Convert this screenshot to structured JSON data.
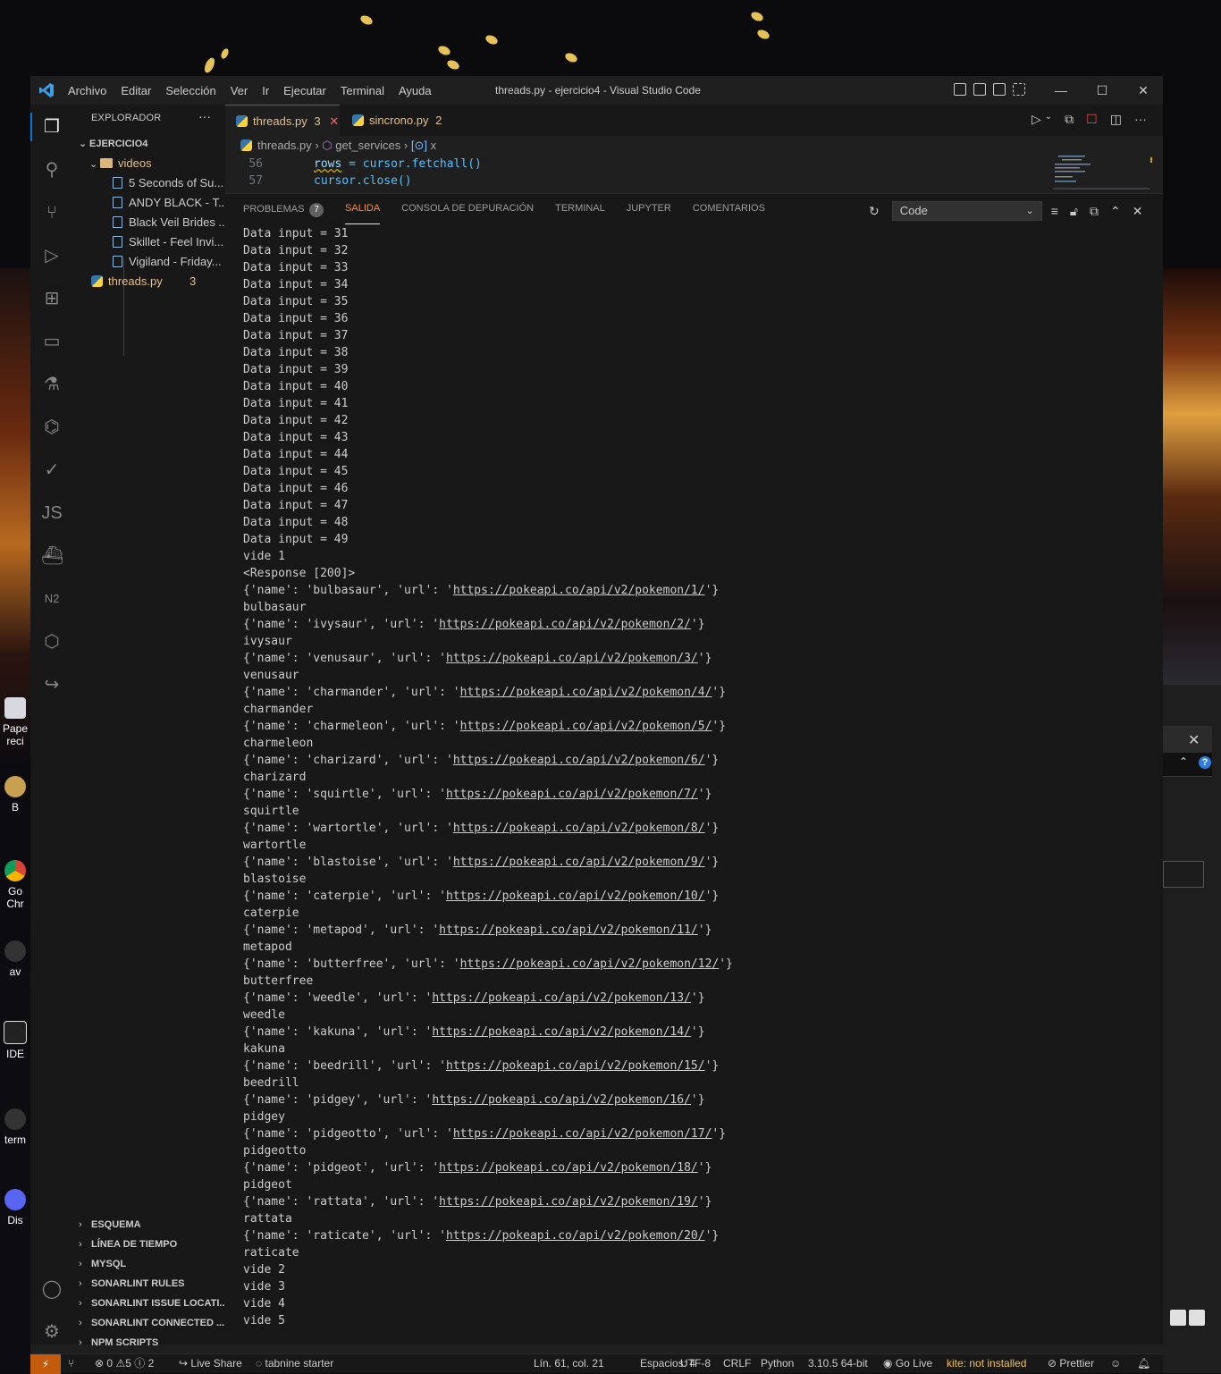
{
  "desktop": {
    "icons": [
      {
        "label": "Pape\nreci",
        "name": "recycle-bin"
      },
      {
        "label": "B",
        "name": "bitcoin-app"
      },
      {
        "label": "Go\nChr",
        "name": "google-chrome"
      },
      {
        "label": "av",
        "name": "app-av"
      },
      {
        "label": "IDE",
        "name": "ide-app"
      },
      {
        "label": "term",
        "name": "terminal-app"
      },
      {
        "label": "Dis",
        "name": "discord-app"
      }
    ]
  },
  "window": {
    "title": "threads.py - ejercicio4 - Visual Studio Code",
    "menu": [
      "Archivo",
      "Editar",
      "Selección",
      "Ver",
      "Ir",
      "Ejecutar",
      "Terminal",
      "Ayuda"
    ]
  },
  "sidebar": {
    "header": "EXPLORADOR",
    "root": "EJERCICIO4",
    "folder": "videos",
    "files": [
      "5 Seconds of Su...",
      "ANDY BLACK - T...",
      "Black Veil Brides ...",
      "Skillet - Feel Invi...",
      "Vigiland - Friday..."
    ],
    "threads_file": {
      "name": "threads.py",
      "problems": "3"
    },
    "sections": [
      "ESQUEMA",
      "LÍNEA DE TIEMPO",
      "MYSQL",
      "SONARLINT RULES",
      "SONARLINT ISSUE LOCATI...",
      "SONARLINT CONNECTED ...",
      "NPM SCRIPTS"
    ]
  },
  "tabs": [
    {
      "label": "threads.py",
      "count": "3",
      "close": "✕"
    },
    {
      "label": "sincrono.py",
      "count": "2"
    }
  ],
  "breadcrumb": {
    "file": "threads.py",
    "symbol": "get_services",
    "variable": "x"
  },
  "code": {
    "lines": [
      {
        "num": "56",
        "var": "rows",
        "rest": " = cursor.fetchall()"
      },
      {
        "num": "57",
        "var": "",
        "rest": "cursor.close()"
      }
    ]
  },
  "panel": {
    "tabs": [
      "PROBLEMAS",
      "SALIDA",
      "CONSOLA DE DEPURACIÓN",
      "TERMINAL",
      "JUPYTER",
      "COMENTARIOS"
    ],
    "problems_count": "7",
    "active_tab": "SALIDA",
    "channel": "Code",
    "output": [
      {
        "t": "Data input = 31"
      },
      {
        "t": "Data input = 32"
      },
      {
        "t": "Data input = 33"
      },
      {
        "t": "Data input = 34"
      },
      {
        "t": "Data input = 35"
      },
      {
        "t": "Data input = 36"
      },
      {
        "t": "Data input = 37"
      },
      {
        "t": "Data input = 38"
      },
      {
        "t": "Data input = 39"
      },
      {
        "t": "Data input = 40"
      },
      {
        "t": "Data input = 41"
      },
      {
        "t": "Data input = 42"
      },
      {
        "t": "Data input = 43"
      },
      {
        "t": "Data input = 44"
      },
      {
        "t": "Data input = 45"
      },
      {
        "t": "Data input = 46"
      },
      {
        "t": "Data input = 47"
      },
      {
        "t": "Data input = 48"
      },
      {
        "t": "Data input = 49"
      },
      {
        "t": "vide 1"
      },
      {
        "t": "<Response [200]>"
      },
      {
        "pre": "{'name': 'bulbasaur', 'url': '",
        "link": "https://pokeapi.co/api/v2/pokemon/1/",
        "post": "'}"
      },
      {
        "t": "bulbasaur"
      },
      {
        "pre": "{'name': 'ivysaur', 'url': '",
        "link": "https://pokeapi.co/api/v2/pokemon/2/",
        "post": "'}"
      },
      {
        "t": "ivysaur"
      },
      {
        "pre": "{'name': 'venusaur', 'url': '",
        "link": "https://pokeapi.co/api/v2/pokemon/3/",
        "post": "'}"
      },
      {
        "t": "venusaur"
      },
      {
        "pre": "{'name': 'charmander', 'url': '",
        "link": "https://pokeapi.co/api/v2/pokemon/4/",
        "post": "'}"
      },
      {
        "t": "charmander"
      },
      {
        "pre": "{'name': 'charmeleon', 'url': '",
        "link": "https://pokeapi.co/api/v2/pokemon/5/",
        "post": "'}"
      },
      {
        "t": "charmeleon"
      },
      {
        "pre": "{'name': 'charizard', 'url': '",
        "link": "https://pokeapi.co/api/v2/pokemon/6/",
        "post": "'}"
      },
      {
        "t": "charizard"
      },
      {
        "pre": "{'name': 'squirtle', 'url': '",
        "link": "https://pokeapi.co/api/v2/pokemon/7/",
        "post": "'}"
      },
      {
        "t": "squirtle"
      },
      {
        "pre": "{'name': 'wartortle', 'url': '",
        "link": "https://pokeapi.co/api/v2/pokemon/8/",
        "post": "'}"
      },
      {
        "t": "wartortle"
      },
      {
        "pre": "{'name': 'blastoise', 'url': '",
        "link": "https://pokeapi.co/api/v2/pokemon/9/",
        "post": "'}"
      },
      {
        "t": "blastoise"
      },
      {
        "pre": "{'name': 'caterpie', 'url': '",
        "link": "https://pokeapi.co/api/v2/pokemon/10/",
        "post": "'}"
      },
      {
        "t": "caterpie"
      },
      {
        "pre": "{'name': 'metapod', 'url': '",
        "link": "https://pokeapi.co/api/v2/pokemon/11/",
        "post": "'}"
      },
      {
        "t": "metapod"
      },
      {
        "pre": "{'name': 'butterfree', 'url': '",
        "link": "https://pokeapi.co/api/v2/pokemon/12/",
        "post": "'}"
      },
      {
        "t": "butterfree"
      },
      {
        "pre": "{'name': 'weedle', 'url': '",
        "link": "https://pokeapi.co/api/v2/pokemon/13/",
        "post": "'}"
      },
      {
        "t": "weedle"
      },
      {
        "pre": "{'name': 'kakuna', 'url': '",
        "link": "https://pokeapi.co/api/v2/pokemon/14/",
        "post": "'}"
      },
      {
        "t": "kakuna"
      },
      {
        "pre": "{'name': 'beedrill', 'url': '",
        "link": "https://pokeapi.co/api/v2/pokemon/15/",
        "post": "'}"
      },
      {
        "t": "beedrill"
      },
      {
        "pre": "{'name': 'pidgey', 'url': '",
        "link": "https://pokeapi.co/api/v2/pokemon/16/",
        "post": "'}"
      },
      {
        "t": "pidgey"
      },
      {
        "pre": "{'name': 'pidgeotto', 'url': '",
        "link": "https://pokeapi.co/api/v2/pokemon/17/",
        "post": "'}"
      },
      {
        "t": "pidgeotto"
      },
      {
        "pre": "{'name': 'pidgeot', 'url': '",
        "link": "https://pokeapi.co/api/v2/pokemon/18/",
        "post": "'}"
      },
      {
        "t": "pidgeot"
      },
      {
        "pre": "{'name': 'rattata', 'url': '",
        "link": "https://pokeapi.co/api/v2/pokemon/19/",
        "post": "'}"
      },
      {
        "t": "rattata"
      },
      {
        "pre": "{'name': 'raticate', 'url': '",
        "link": "https://pokeapi.co/api/v2/pokemon/20/",
        "post": "'}"
      },
      {
        "t": "raticate"
      },
      {
        "t": "vide 2"
      },
      {
        "t": "vide 3"
      },
      {
        "t": "vide 4"
      },
      {
        "t": "vide 5"
      }
    ]
  },
  "statusbar": {
    "errors": "0",
    "warnings": "5",
    "infos": "2",
    "live_share": "Live Share",
    "tabnine": "tabnine starter",
    "position": "Lín. 61, col. 21",
    "spaces": "Espacios: 4",
    "encoding": "UTF-8",
    "eol": "CRLF",
    "language": "Python",
    "interpreter": "3.10.5 64-bit",
    "go_live": "Go Live",
    "kite": "kite: not installed",
    "prettier": "Prettier"
  },
  "colors": {
    "accent": "#0078d4",
    "active_tab_label": "#e2c08d",
    "remote_indicator": "#c25b0c"
  }
}
